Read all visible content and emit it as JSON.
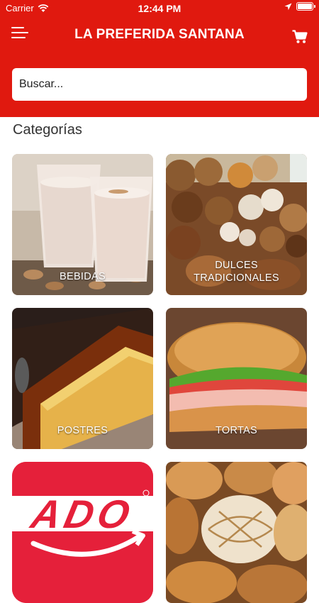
{
  "status_bar": {
    "carrier": "Carrier",
    "time": "12:44 PM"
  },
  "header": {
    "title": "LA PREFERIDA SANTANA",
    "menu_icon": "hamburger-menu-icon",
    "cart_icon": "shopping-cart-icon"
  },
  "search": {
    "placeholder": "Buscar...",
    "value": ""
  },
  "section": {
    "title": "Categorías"
  },
  "categories": [
    {
      "label": "BEBIDAS"
    },
    {
      "label_line1": "DULCES",
      "label_line2": "TRADICIONALES"
    },
    {
      "label": "POSTRES"
    },
    {
      "label": "TORTAS"
    },
    {
      "logo_text": "ADO"
    },
    {
      "label": ""
    }
  ],
  "colors": {
    "brand_red": "#e0190f",
    "ado_red": "#e5203a"
  }
}
